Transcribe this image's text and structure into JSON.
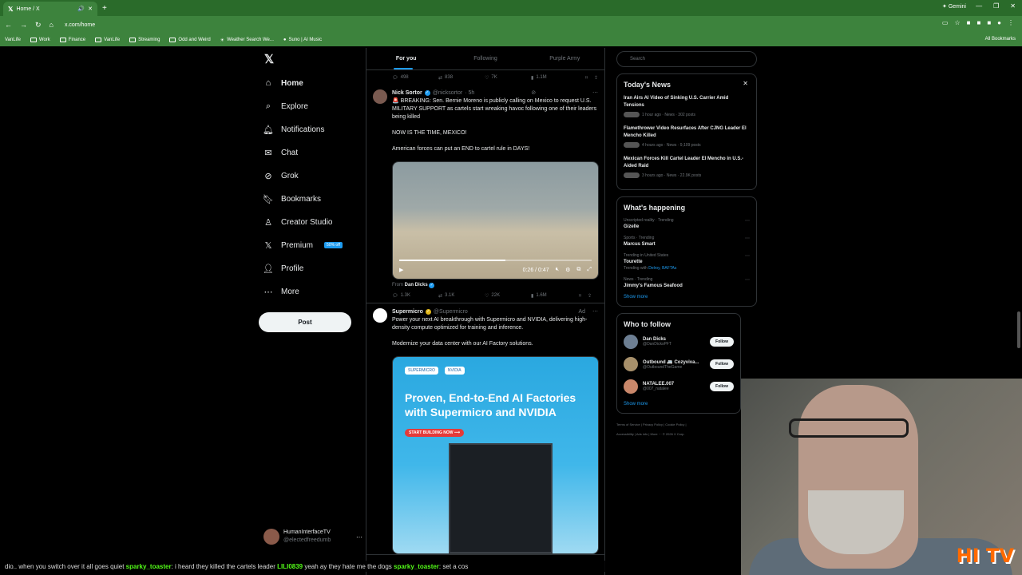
{
  "browser": {
    "tab_title": "Home / X",
    "url": "x.com/home",
    "gemini_label": "Gemini",
    "bookmarks": [
      "VanLife",
      "Work",
      "Finance",
      "VanLife",
      "Streaming",
      "Odd and Weird",
      "Weather Search We...",
      "Suno | AI Music"
    ],
    "all_bookmarks": "All Bookmarks"
  },
  "nav": {
    "items": [
      {
        "label": "Home",
        "icon": "home-icon"
      },
      {
        "label": "Explore",
        "icon": "search-icon"
      },
      {
        "label": "Notifications",
        "icon": "bell-icon"
      },
      {
        "label": "Chat",
        "icon": "mail-icon"
      },
      {
        "label": "Grok",
        "icon": "grok-icon"
      },
      {
        "label": "Bookmarks",
        "icon": "bookmark-icon"
      },
      {
        "label": "Creator Studio",
        "icon": "creator-icon"
      },
      {
        "label": "Premium",
        "icon": "x-icon",
        "badge": "50% off"
      },
      {
        "label": "Profile",
        "icon": "person-icon"
      },
      {
        "label": "More",
        "icon": "more-icon"
      }
    ],
    "post_label": "Post",
    "account_name": "HumanInterfaceTV",
    "account_handle": "@electedfreedumb"
  },
  "feed": {
    "tabs": [
      "For you",
      "Following",
      "Purple Army"
    ],
    "top_actions": [
      "498",
      "838",
      "7K",
      "1.1M"
    ],
    "tweet1": {
      "name": "Nick Sortor",
      "handle": "@nicksortor",
      "time": "· 5h",
      "text1": "🚨 BREAKING: Sen. Bernie Moreno is publicly calling on Mexico to request U.S. MILITARY SUPPORT as cartels start wreaking havoc following one of their leaders being killed",
      "text2": "NOW IS THE TIME, MEXICO!",
      "text3": "American forces can put an END to cartel rule in DAYS!",
      "video_time": "0:26 / 0:47",
      "video_progress": 0.55,
      "from_label": "From",
      "from_name": "Dan Dicks",
      "actions": [
        "1.3K",
        "3.1K",
        "22K",
        "1.6M"
      ]
    },
    "tweet2": {
      "name": "Supermicro",
      "handle": "@Supermicro",
      "ad_label": "Ad",
      "text1": "Power your next AI breakthrough with Supermicro and NVIDIA, delivering high-density compute optimized for training and inference.",
      "text2": "Modernize your data center with our AI Factory solutions.",
      "headline": "Proven, End-to-End AI Factories with Supermicro and NVIDIA",
      "cta": "START BUILDING NOW ⟶",
      "logo1": "SUPERMICRO",
      "logo2": "NVIDIA"
    }
  },
  "right": {
    "search_placeholder": "Search",
    "news_title": "Today's News",
    "news": [
      {
        "title": "Iran Airs AI Video of Sinking U.S. Carrier Amid Tensions",
        "meta": "1 hour ago · News · 302 posts"
      },
      {
        "title": "Flamethrower Video Resurfaces After CJNG Leader El Mencho Killed",
        "meta": "4 hours ago · News · 9,109 posts"
      },
      {
        "title": "Mexican Forces Kill Cartel Leader El Mencho in U.S.-Aided Raid",
        "meta": "3 hours ago · News · 22.9K posts"
      }
    ],
    "happening_title": "What's happening",
    "trends": [
      {
        "ctx": "Unscripted reality · Trending",
        "name": "Gizelle",
        "with": ""
      },
      {
        "ctx": "Sports · Trending",
        "name": "Marcus Smart",
        "with": ""
      },
      {
        "ctx": "Trending in United States",
        "name": "Tourette",
        "with_label": "Trending with",
        "with": "Delroy, BAFTAs"
      },
      {
        "ctx": "News · Trending",
        "name": "Jimmy's Famous Seafood",
        "with": ""
      }
    ],
    "show_more": "Show more",
    "wtf_title": "Who to follow",
    "follow": [
      {
        "name": "Dan Dicks",
        "handle": "@DanDicksPFT"
      },
      {
        "name": "Outbound 🚐 Cozyviva...",
        "handle": "@OutboundTheGame"
      },
      {
        "name": "NATALEE.007",
        "handle": "@007_natalee"
      }
    ],
    "follow_label": "Follow",
    "footer1": "Terms of Service  |  Privacy Policy  |  Cookie Policy  |",
    "footer2": "Accessibility  |  Ads info  |  More ···  © 2026 X Corp."
  },
  "ticker": {
    "text1": "dio.. when you switch over it all goes quiet",
    "user1": "sparky_toaster",
    "text2": ": i heard they killed the cartels leader",
    "user2": "LILI0839",
    "text3": "yeah ay they hate me the dogs",
    "user3": "sparky_toaster",
    "text4": ": set a cos"
  },
  "overlay": {
    "logo": "HI TV"
  },
  "colors": {
    "accent": "#1d9bf0",
    "chrome": "#3d833d",
    "bg": "#000000"
  }
}
